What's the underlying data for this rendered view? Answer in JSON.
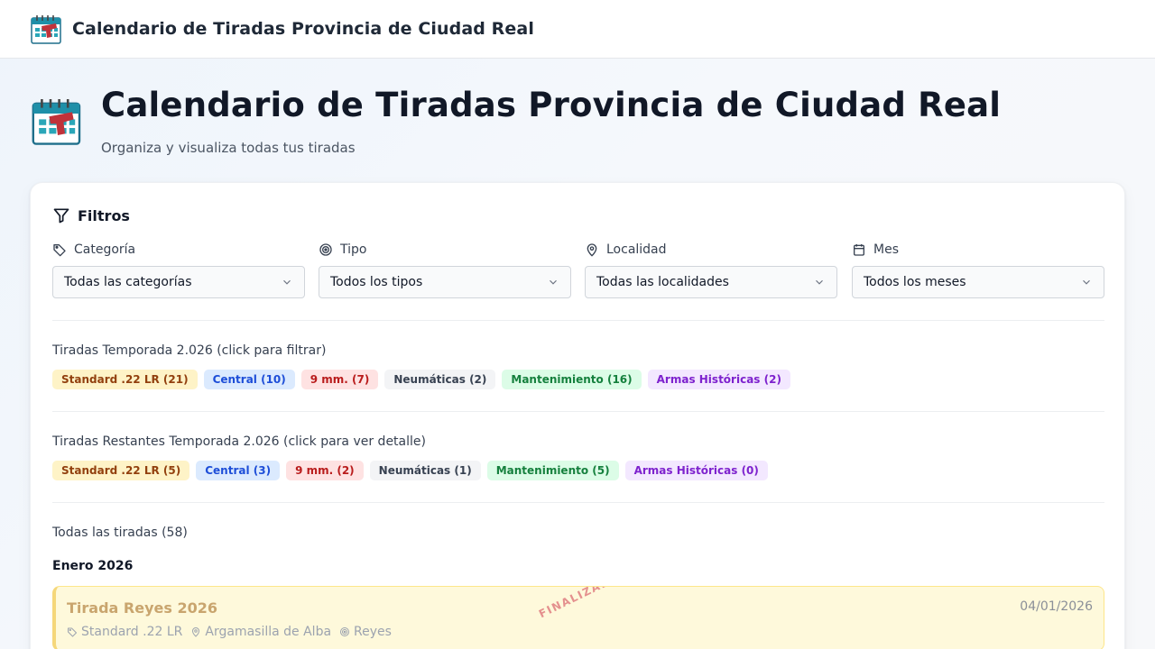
{
  "app": {
    "title": "Calendario de Tiradas Provincia de Ciudad Real",
    "header_title": "Calendario de Tiradas Provincia de Ciudad Real",
    "subtitle": "Organiza y visualiza todas tus tiradas"
  },
  "filters": {
    "heading": "Filtros",
    "groups": [
      {
        "label": "Categoría",
        "value": "Todas las categorías",
        "icon": "tag-icon"
      },
      {
        "label": "Tipo",
        "value": "Todos los tipos",
        "icon": "target-icon"
      },
      {
        "label": "Localidad",
        "value": "Todas las localidades",
        "icon": "map-pin-icon"
      },
      {
        "label": "Mes",
        "value": "Todos los meses",
        "icon": "calendar-icon"
      }
    ]
  },
  "season": {
    "title": "Tiradas Temporada 2.026 (click para filtrar)",
    "chips": [
      "Standard .22 LR (21)",
      "Central (10)",
      "9 mm. (7)",
      "Neumáticas (2)",
      "Mantenimiento (16)",
      "Armas Históricas (2)"
    ]
  },
  "remaining": {
    "title": "Tiradas Restantes Temporada 2.026 (click para ver detalle)",
    "chips": [
      "Standard .22 LR (5)",
      "Central (3)",
      "9 mm. (2)",
      "Neumáticas (1)",
      "Mantenimiento (5)",
      "Armas Históricas (0)"
    ]
  },
  "all": {
    "title": "Todas las tiradas (58)",
    "month": "Enero 2026",
    "events": [
      {
        "title": "Tirada Reyes 2026",
        "date": "04/01/2026",
        "category": "Standard .22 LR",
        "location": "Argamasilla de Alba",
        "type": "Reyes",
        "status": "FINALIZADA"
      }
    ]
  },
  "colors": {
    "standard": "#fef3c7",
    "central": "#dbeafe",
    "nine_mm": "#fee2e2",
    "neumaticas": "#f3f4f6",
    "mantenimiento": "#dcfce7",
    "armas_historicas": "#f3e8ff",
    "finished_event_bg": "#fef9db"
  }
}
